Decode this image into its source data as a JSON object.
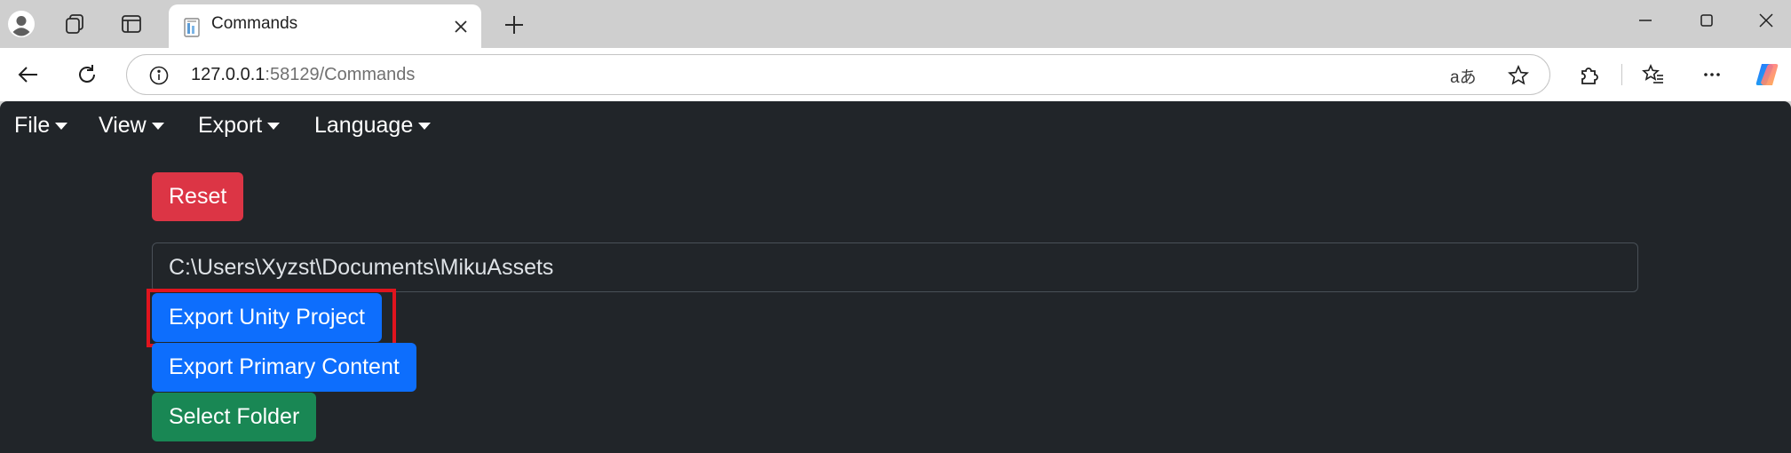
{
  "browser": {
    "tab": {
      "title": "Commands",
      "favicon": "document-icon"
    },
    "address": {
      "host": "127.0.0.1",
      "port_path": ":58129/Commands"
    },
    "icons": [
      "profile-icon",
      "collections-icon",
      "tab-actions-icon",
      "close-icon",
      "plus-icon",
      "minimize-icon",
      "maximize-icon",
      "close-window-icon",
      "back-icon",
      "refresh-icon",
      "info-icon",
      "star-icon",
      "extensions-icon",
      "favorites-icon",
      "more-icon",
      "copilot-icon"
    ],
    "read_aloud_glyph": "aあ"
  },
  "menubar": {
    "items": [
      {
        "label": "File"
      },
      {
        "label": "View"
      },
      {
        "label": "Export"
      },
      {
        "label": "Language"
      }
    ]
  },
  "commands": {
    "reset_label": "Reset",
    "path_value": "C:\\Users\\Xyzst\\Documents\\MikuAssets",
    "export_unity_label": "Export Unity Project",
    "export_primary_label": "Export Primary Content",
    "select_folder_label": "Select Folder"
  },
  "colors": {
    "page_bg": "#212529",
    "danger": "#dc3545",
    "primary": "#0d6efd",
    "success": "#198754",
    "highlight": "#e0141e"
  }
}
